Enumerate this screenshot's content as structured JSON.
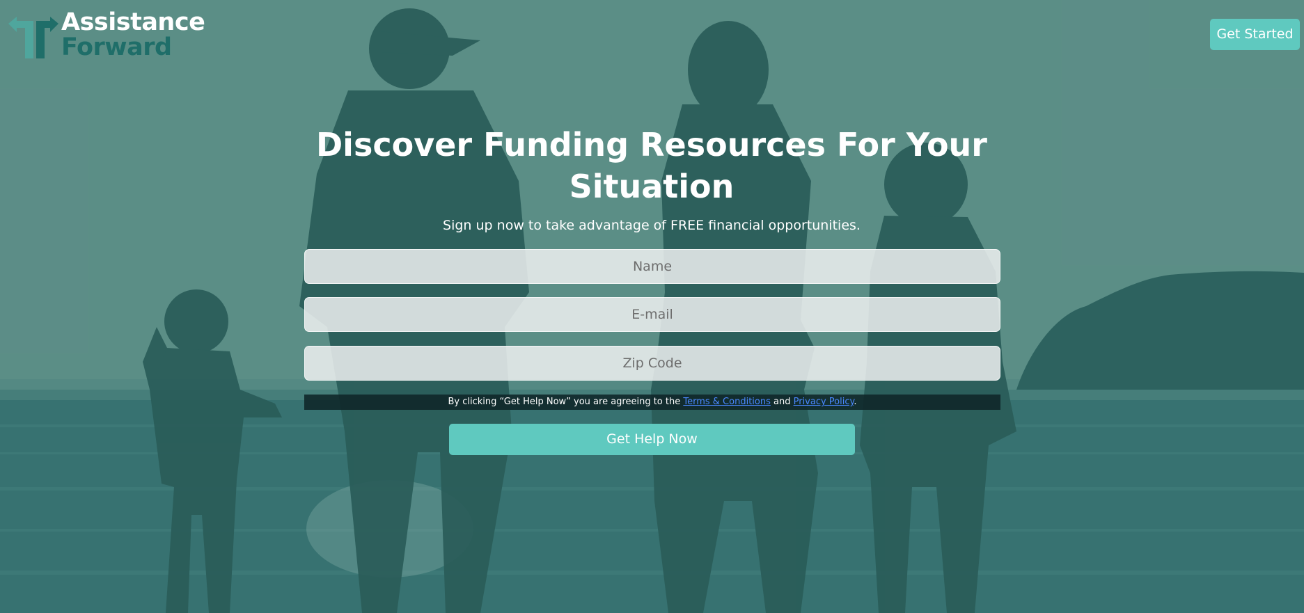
{
  "header": {
    "logo_line1": "Assistance",
    "logo_line2": "Forward",
    "get_started_label": "Get Started"
  },
  "hero": {
    "headline": "Discover Funding Resources For Your Situation",
    "subhead": "Sign up now to take advantage of FREE financial opportunities."
  },
  "form": {
    "name_placeholder": "Name",
    "email_placeholder": "E-mail",
    "zip_placeholder": "Zip Code",
    "disclaimer_prefix": "By clicking “Get Help Now” you are agreeing to the ",
    "terms_link": "Terms & Conditions",
    "disclaimer_and": " and ",
    "privacy_link": "Privacy Policy",
    "disclaimer_suffix": ".",
    "submit_label": "Get Help Now"
  },
  "colors": {
    "accent": "#5fc9bf",
    "logo_dark": "#1f6e69",
    "overlay": "#3f7474",
    "link": "#4a88ff"
  },
  "icons": {
    "logo_mark": "turn-arrows-icon"
  }
}
